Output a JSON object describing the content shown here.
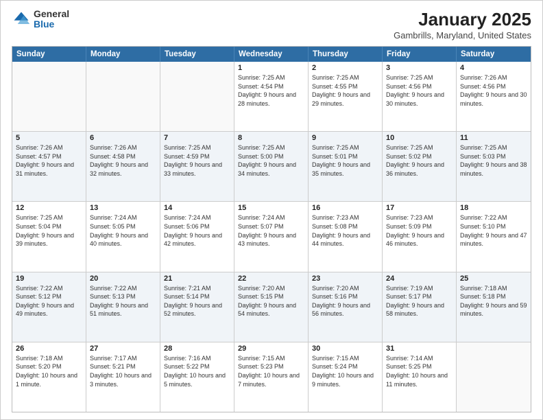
{
  "logo": {
    "general": "General",
    "blue": "Blue"
  },
  "title": "January 2025",
  "subtitle": "Gambrills, Maryland, United States",
  "days_of_week": [
    "Sunday",
    "Monday",
    "Tuesday",
    "Wednesday",
    "Thursday",
    "Friday",
    "Saturday"
  ],
  "weeks": [
    [
      {
        "day": "",
        "sunrise": "",
        "sunset": "",
        "daylight": "",
        "empty": true
      },
      {
        "day": "",
        "sunrise": "",
        "sunset": "",
        "daylight": "",
        "empty": true
      },
      {
        "day": "",
        "sunrise": "",
        "sunset": "",
        "daylight": "",
        "empty": true
      },
      {
        "day": "1",
        "sunrise": "Sunrise: 7:25 AM",
        "sunset": "Sunset: 4:54 PM",
        "daylight": "Daylight: 9 hours and 28 minutes."
      },
      {
        "day": "2",
        "sunrise": "Sunrise: 7:25 AM",
        "sunset": "Sunset: 4:55 PM",
        "daylight": "Daylight: 9 hours and 29 minutes."
      },
      {
        "day": "3",
        "sunrise": "Sunrise: 7:25 AM",
        "sunset": "Sunset: 4:56 PM",
        "daylight": "Daylight: 9 hours and 30 minutes."
      },
      {
        "day": "4",
        "sunrise": "Sunrise: 7:26 AM",
        "sunset": "Sunset: 4:56 PM",
        "daylight": "Daylight: 9 hours and 30 minutes."
      }
    ],
    [
      {
        "day": "5",
        "sunrise": "Sunrise: 7:26 AM",
        "sunset": "Sunset: 4:57 PM",
        "daylight": "Daylight: 9 hours and 31 minutes."
      },
      {
        "day": "6",
        "sunrise": "Sunrise: 7:26 AM",
        "sunset": "Sunset: 4:58 PM",
        "daylight": "Daylight: 9 hours and 32 minutes."
      },
      {
        "day": "7",
        "sunrise": "Sunrise: 7:25 AM",
        "sunset": "Sunset: 4:59 PM",
        "daylight": "Daylight: 9 hours and 33 minutes."
      },
      {
        "day": "8",
        "sunrise": "Sunrise: 7:25 AM",
        "sunset": "Sunset: 5:00 PM",
        "daylight": "Daylight: 9 hours and 34 minutes."
      },
      {
        "day": "9",
        "sunrise": "Sunrise: 7:25 AM",
        "sunset": "Sunset: 5:01 PM",
        "daylight": "Daylight: 9 hours and 35 minutes."
      },
      {
        "day": "10",
        "sunrise": "Sunrise: 7:25 AM",
        "sunset": "Sunset: 5:02 PM",
        "daylight": "Daylight: 9 hours and 36 minutes."
      },
      {
        "day": "11",
        "sunrise": "Sunrise: 7:25 AM",
        "sunset": "Sunset: 5:03 PM",
        "daylight": "Daylight: 9 hours and 38 minutes."
      }
    ],
    [
      {
        "day": "12",
        "sunrise": "Sunrise: 7:25 AM",
        "sunset": "Sunset: 5:04 PM",
        "daylight": "Daylight: 9 hours and 39 minutes."
      },
      {
        "day": "13",
        "sunrise": "Sunrise: 7:24 AM",
        "sunset": "Sunset: 5:05 PM",
        "daylight": "Daylight: 9 hours and 40 minutes."
      },
      {
        "day": "14",
        "sunrise": "Sunrise: 7:24 AM",
        "sunset": "Sunset: 5:06 PM",
        "daylight": "Daylight: 9 hours and 42 minutes."
      },
      {
        "day": "15",
        "sunrise": "Sunrise: 7:24 AM",
        "sunset": "Sunset: 5:07 PM",
        "daylight": "Daylight: 9 hours and 43 minutes."
      },
      {
        "day": "16",
        "sunrise": "Sunrise: 7:23 AM",
        "sunset": "Sunset: 5:08 PM",
        "daylight": "Daylight: 9 hours and 44 minutes."
      },
      {
        "day": "17",
        "sunrise": "Sunrise: 7:23 AM",
        "sunset": "Sunset: 5:09 PM",
        "daylight": "Daylight: 9 hours and 46 minutes."
      },
      {
        "day": "18",
        "sunrise": "Sunrise: 7:22 AM",
        "sunset": "Sunset: 5:10 PM",
        "daylight": "Daylight: 9 hours and 47 minutes."
      }
    ],
    [
      {
        "day": "19",
        "sunrise": "Sunrise: 7:22 AM",
        "sunset": "Sunset: 5:12 PM",
        "daylight": "Daylight: 9 hours and 49 minutes."
      },
      {
        "day": "20",
        "sunrise": "Sunrise: 7:22 AM",
        "sunset": "Sunset: 5:13 PM",
        "daylight": "Daylight: 9 hours and 51 minutes."
      },
      {
        "day": "21",
        "sunrise": "Sunrise: 7:21 AM",
        "sunset": "Sunset: 5:14 PM",
        "daylight": "Daylight: 9 hours and 52 minutes."
      },
      {
        "day": "22",
        "sunrise": "Sunrise: 7:20 AM",
        "sunset": "Sunset: 5:15 PM",
        "daylight": "Daylight: 9 hours and 54 minutes."
      },
      {
        "day": "23",
        "sunrise": "Sunrise: 7:20 AM",
        "sunset": "Sunset: 5:16 PM",
        "daylight": "Daylight: 9 hours and 56 minutes."
      },
      {
        "day": "24",
        "sunrise": "Sunrise: 7:19 AM",
        "sunset": "Sunset: 5:17 PM",
        "daylight": "Daylight: 9 hours and 58 minutes."
      },
      {
        "day": "25",
        "sunrise": "Sunrise: 7:18 AM",
        "sunset": "Sunset: 5:18 PM",
        "daylight": "Daylight: 9 hours and 59 minutes."
      }
    ],
    [
      {
        "day": "26",
        "sunrise": "Sunrise: 7:18 AM",
        "sunset": "Sunset: 5:20 PM",
        "daylight": "Daylight: 10 hours and 1 minute."
      },
      {
        "day": "27",
        "sunrise": "Sunrise: 7:17 AM",
        "sunset": "Sunset: 5:21 PM",
        "daylight": "Daylight: 10 hours and 3 minutes."
      },
      {
        "day": "28",
        "sunrise": "Sunrise: 7:16 AM",
        "sunset": "Sunset: 5:22 PM",
        "daylight": "Daylight: 10 hours and 5 minutes."
      },
      {
        "day": "29",
        "sunrise": "Sunrise: 7:15 AM",
        "sunset": "Sunset: 5:23 PM",
        "daylight": "Daylight: 10 hours and 7 minutes."
      },
      {
        "day": "30",
        "sunrise": "Sunrise: 7:15 AM",
        "sunset": "Sunset: 5:24 PM",
        "daylight": "Daylight: 10 hours and 9 minutes."
      },
      {
        "day": "31",
        "sunrise": "Sunrise: 7:14 AM",
        "sunset": "Sunset: 5:25 PM",
        "daylight": "Daylight: 10 hours and 11 minutes."
      },
      {
        "day": "",
        "sunrise": "",
        "sunset": "",
        "daylight": "",
        "empty": true
      }
    ]
  ]
}
